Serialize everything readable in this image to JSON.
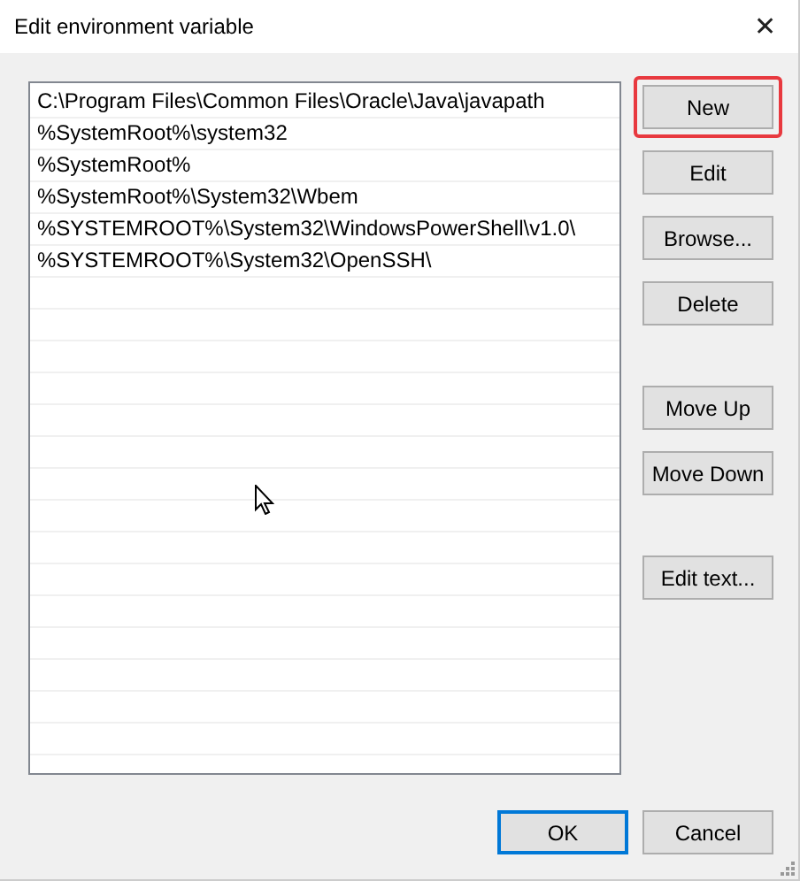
{
  "window": {
    "title": "Edit environment variable",
    "close": "✕"
  },
  "paths": [
    "C:\\Program Files\\Common Files\\Oracle\\Java\\javapath",
    "%SystemRoot%\\system32",
    "%SystemRoot%",
    "%SystemRoot%\\System32\\Wbem",
    "%SYSTEMROOT%\\System32\\WindowsPowerShell\\v1.0\\",
    "%SYSTEMROOT%\\System32\\OpenSSH\\"
  ],
  "side_groups": [
    {
      "buttons": [
        {
          "label": "New",
          "highlighted": true
        },
        {
          "label": "Edit",
          "highlighted": false
        },
        {
          "label": "Browse...",
          "highlighted": false
        },
        {
          "label": "Delete",
          "highlighted": false
        }
      ]
    },
    {
      "buttons": [
        {
          "label": "Move Up",
          "highlighted": false
        },
        {
          "label": "Move Down",
          "highlighted": false
        }
      ]
    },
    {
      "buttons": [
        {
          "label": "Edit text...",
          "highlighted": false
        }
      ]
    }
  ],
  "footer_buttons": [
    {
      "label": "OK",
      "default": true
    },
    {
      "label": "Cancel",
      "default": false
    }
  ]
}
